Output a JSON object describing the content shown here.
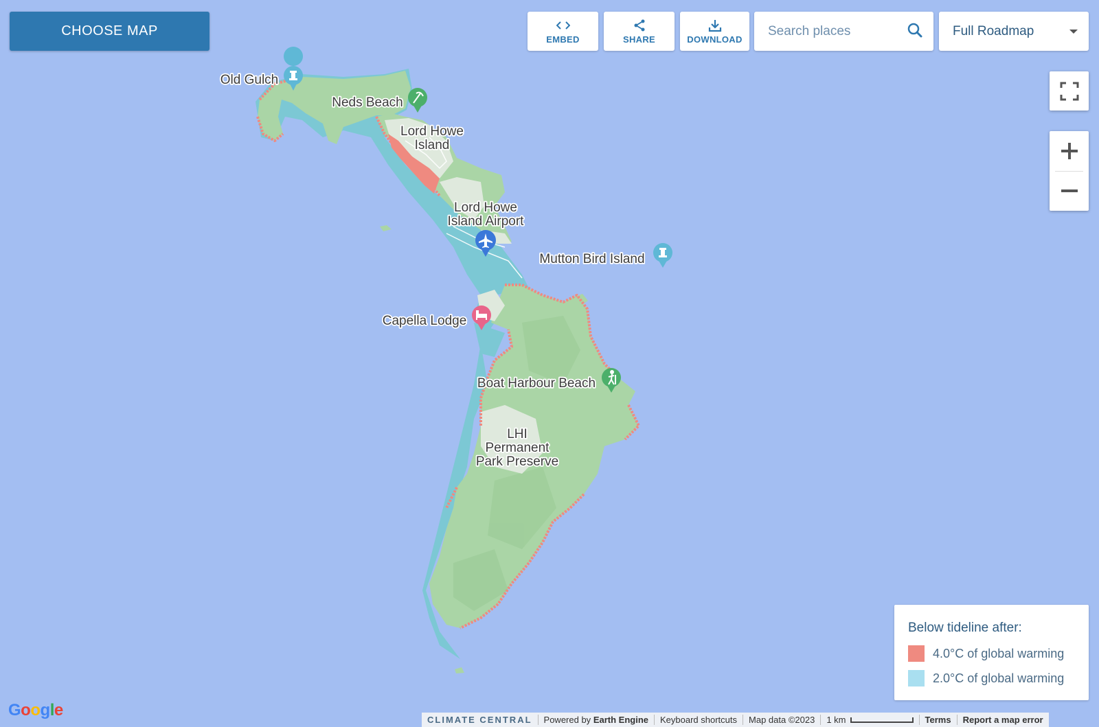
{
  "toolbar": {
    "choose_map": "CHOOSE MAP",
    "embed": "EMBED",
    "share": "SHARE",
    "download": "DOWNLOAD",
    "search_placeholder": "Search places",
    "map_type": "Full Roadmap"
  },
  "places": {
    "old_gulch": "Old Gulch",
    "neds_beach": "Neds Beach",
    "lhi_line1": "Lord Howe",
    "lhi_line2": "Island",
    "airport_line1": "Lord Howe",
    "airport_line2": "Island Airport",
    "mutton_bird": "Mutton Bird Island",
    "capella": "Capella Lodge",
    "boat_harbour": "Boat Harbour Beach",
    "park_line1": "LHI",
    "park_line2": "Permanent",
    "park_line3": "Park Preserve"
  },
  "legend": {
    "title": "Below tideline after:",
    "items": [
      {
        "label": "4.0°C of global warming",
        "color": "#ef8a80"
      },
      {
        "label": "2.0°C of global warming",
        "color": "#a9dff0"
      }
    ]
  },
  "footer": {
    "brand": "CLIMATE CENTRAL",
    "powered_prefix": "Powered by",
    "powered_name": "Earth Engine",
    "shortcuts": "Keyboard shortcuts",
    "map_data": "Map data ©2023",
    "scale": "1 km",
    "terms": "Terms",
    "report": "Report a map error"
  },
  "google_logo": "Google",
  "colors": {
    "water": "#a3bef2",
    "land": "#aad5a6",
    "town": "#dfe9dd",
    "inundation_4c": "#ef8a80",
    "inundation_2c": "#7cc8d4",
    "accent": "#2e78b0"
  }
}
